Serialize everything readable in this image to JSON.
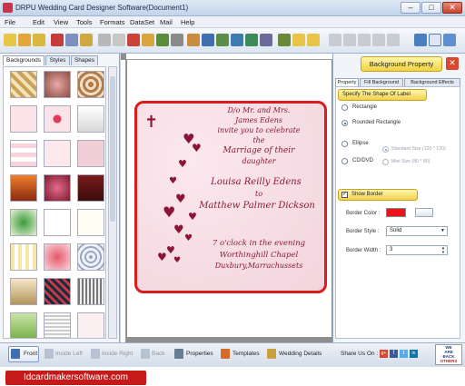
{
  "window": {
    "title": "DRPU Wedding Card Designer Software(Document1)",
    "minimize": "–",
    "maximize": "□",
    "close": "✕"
  },
  "menu": [
    "File",
    "Edit",
    "View",
    "Tools",
    "Formats",
    "DataSet",
    "Mail",
    "Help"
  ],
  "left_panel": {
    "tabs": [
      "Backgrounds",
      "Styles",
      "Shapes"
    ],
    "active_tab": "Backgrounds"
  },
  "card": {
    "line1": "D/o Mr. and Mrs.",
    "line2": "James Edens",
    "line3": "invite you to celebrate",
    "line4": "the",
    "line5": "Marriage of their",
    "line6": "daughter",
    "bride": "Louisa Reilly Edens",
    "to": "to",
    "groom": "Matthew Palmer Dickson",
    "time": "7 o'clock in the evening",
    "venue": "Worthinghill Chapel",
    "place": "Duxbury,Marrachussets",
    "cross": "✝"
  },
  "right_panel": {
    "header": "Background Property",
    "close": "✕",
    "tabs": [
      "Property",
      "Fill Background",
      "Background Effects"
    ],
    "shape_section": "Specify The Shape Of Label",
    "shapes": [
      "Rectangle",
      "Rounded Rectangle",
      "Ellipse",
      "CD/DVD"
    ],
    "selected_shape": "Rounded Rectangle",
    "sizes": [
      "Standard Size (120 * 120)",
      "Mini Size (80 * 80)"
    ],
    "show_border": "Show Border",
    "border_color_label": "Border Color :",
    "border_color": "#e8141a",
    "border_style_label": "Border Style :",
    "border_style": "Solid",
    "border_width_label": "Border Width :",
    "border_width": "3"
  },
  "bottom_bar": {
    "items": [
      "Front",
      "Inside Left",
      "Inside Right",
      "Back",
      "Properties",
      "Templates",
      "Wedding Details"
    ],
    "share": "Share Us On :",
    "social": [
      "g+",
      "f",
      "t",
      "in"
    ],
    "badge": [
      "WE",
      "ARE",
      "BACK",
      "OTHERS"
    ]
  },
  "footer": {
    "url": "Idcardmakersoftware.com"
  },
  "colors": {
    "accent_red": "#d81d1d",
    "heart": "#8a1537",
    "panel_yellow": "#f2d23c"
  }
}
